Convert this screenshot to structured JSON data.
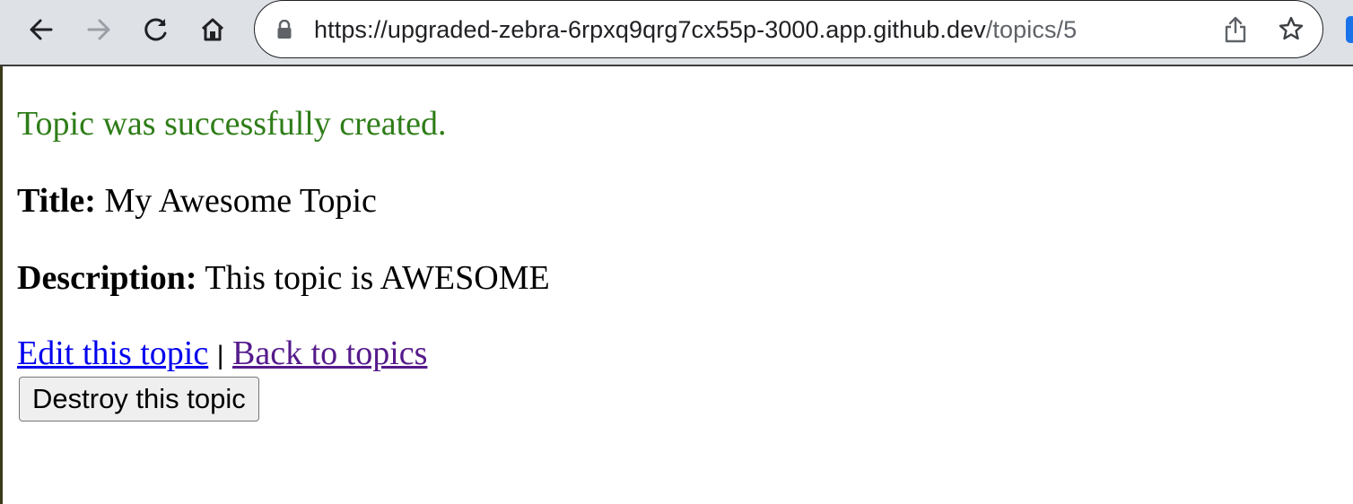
{
  "browser": {
    "url_base": "https://upgraded-zebra-6rpxq9qrg7cx55p-3000.app.github.dev",
    "url_path": "/topics/5",
    "icons": {
      "back": "arrow-left-icon",
      "forward": "arrow-right-icon",
      "reload": "reload-icon",
      "home": "home-icon",
      "lock": "lock-icon",
      "share": "share-icon",
      "bookmark": "star-icon"
    }
  },
  "page": {
    "notice": "Topic was successfully created.",
    "title_label": "Title:",
    "title_value": "My Awesome Topic",
    "description_label": "Description:",
    "description_value": "This topic is AWESOME",
    "edit_link": "Edit this topic",
    "separator": "|",
    "back_link": "Back to topics",
    "destroy_button": "Destroy this topic"
  },
  "colors": {
    "notice": "#2e7d18",
    "link": "#0000ee",
    "visited_link": "#551a8b",
    "toolbar_bg": "#dee1e6"
  }
}
